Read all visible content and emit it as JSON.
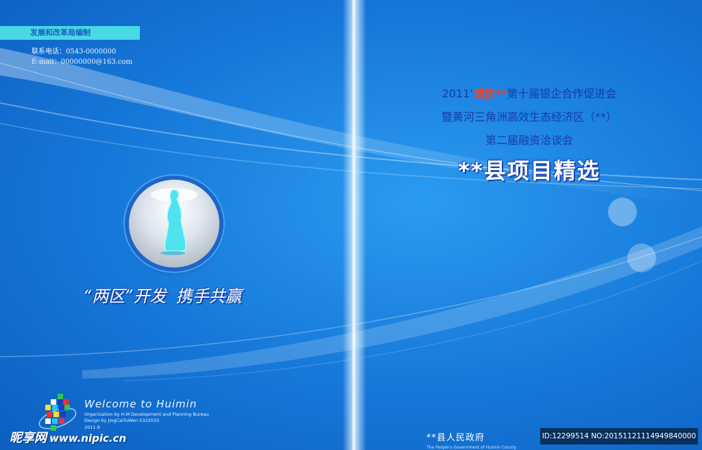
{
  "left_cover": {
    "tag": "发展和改革局编制",
    "contact_phone": "联系电话：0543-0000000",
    "contact_email": "E-mail：00000000@163.com",
    "slogan_part1": "“两区”开发",
    "slogan_part2": "携手共赢"
  },
  "right_cover": {
    "title_line1_pre": "2011’",
    "title_line1_red": "诚信**",
    "title_line1_post": "第十届银企合作促进会",
    "title_line2": "暨黄河三角洲高效生态经济区（**）",
    "title_line3": "第二届融资洽谈会",
    "main_title": "**县项目精选",
    "government": "**县人民政府",
    "government_en": "The People's Government of Huimin County"
  },
  "welcome": {
    "title": "Welcome to Huimin",
    "organization": "Organization  by  H.M Development and Planning Bureau",
    "design": "Design by  JingCaiTuWen 5322033",
    "date": "2011.9"
  },
  "watermark": {
    "brand": "昵享网",
    "url": "www.nipic.cn",
    "id_text": "ID:12299514 NO:20151121114949840000"
  },
  "colors": {
    "background": "#1577d8",
    "accent_cyan": "#49d8e6",
    "title_blue": "#173aa8",
    "title_red": "#ff3b1f"
  },
  "logo_cells": [
    {
      "c": "#2ec84a"
    },
    {
      "c": "#ffffff"
    },
    {
      "c": "#1a3fbf"
    },
    {
      "c": "#ff2b2b"
    },
    {
      "c": "#ffde2b"
    },
    {
      "c": "#25c8f5"
    },
    {
      "c": "#1a3fbf"
    },
    {
      "c": "#2ec84a"
    },
    {
      "c": "#ff2b2b"
    },
    {
      "c": "#ffde2b"
    },
    {
      "c": "#1a3fbf"
    },
    {
      "c": "#ffffff"
    },
    {
      "c": "#25c8f5"
    },
    {
      "c": "#ff2b2b"
    },
    {
      "c": "#2ec84a"
    }
  ]
}
